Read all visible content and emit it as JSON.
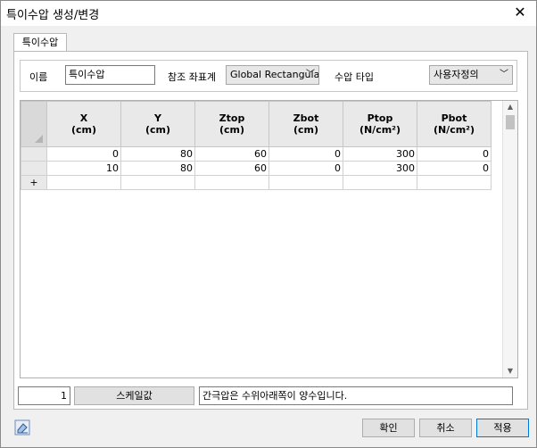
{
  "window": {
    "title": "특이수압 생성/변경"
  },
  "tab": {
    "label": "특이수압"
  },
  "form": {
    "name_label": "이름",
    "name_value": "특이수압",
    "ref_coord_label": "참조 좌표계",
    "ref_coord_value": "Global Rectangula",
    "pressure_type_label": "수압 타입",
    "pressure_type_value": "사용자정의"
  },
  "grid": {
    "columns": [
      {
        "name": "X",
        "unit": "(cm)"
      },
      {
        "name": "Y",
        "unit": "(cm)"
      },
      {
        "name": "Ztop",
        "unit": "(cm)"
      },
      {
        "name": "Zbot",
        "unit": "(cm)"
      },
      {
        "name": "Ptop",
        "unit": "(N/cm²)"
      },
      {
        "name": "Pbot",
        "unit": "(N/cm²)"
      }
    ],
    "rows": [
      [
        "0",
        "80",
        "60",
        "0",
        "300",
        "0"
      ],
      [
        "10",
        "80",
        "60",
        "0",
        "300",
        "0"
      ]
    ],
    "add_row_symbol": "+"
  },
  "footer": {
    "scale_value": "1",
    "scale_button": "스케일값",
    "message": "간극압은 수위아래쪽이 양수입니다."
  },
  "buttons": {
    "ok": "확인",
    "cancel": "취소",
    "apply": "적용"
  }
}
